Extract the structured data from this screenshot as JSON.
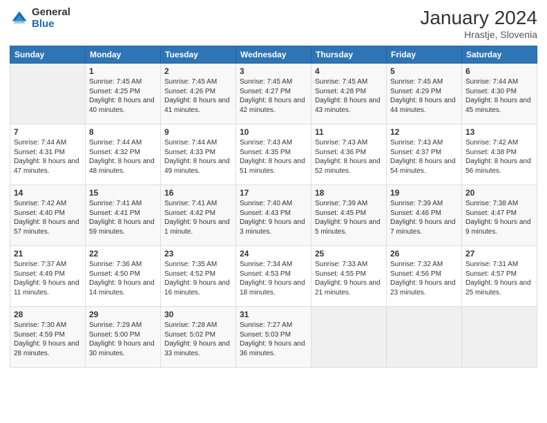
{
  "header": {
    "logo_general": "General",
    "logo_blue": "Blue",
    "month_year": "January 2024",
    "location": "Hrastje, Slovenia"
  },
  "weekdays": [
    "Sunday",
    "Monday",
    "Tuesday",
    "Wednesday",
    "Thursday",
    "Friday",
    "Saturday"
  ],
  "weeks": [
    [
      {
        "day": "",
        "sunrise": "",
        "sunset": "",
        "daylight": ""
      },
      {
        "day": "1",
        "sunrise": "Sunrise: 7:45 AM",
        "sunset": "Sunset: 4:25 PM",
        "daylight": "Daylight: 8 hours and 40 minutes."
      },
      {
        "day": "2",
        "sunrise": "Sunrise: 7:45 AM",
        "sunset": "Sunset: 4:26 PM",
        "daylight": "Daylight: 8 hours and 41 minutes."
      },
      {
        "day": "3",
        "sunrise": "Sunrise: 7:45 AM",
        "sunset": "Sunset: 4:27 PM",
        "daylight": "Daylight: 8 hours and 42 minutes."
      },
      {
        "day": "4",
        "sunrise": "Sunrise: 7:45 AM",
        "sunset": "Sunset: 4:28 PM",
        "daylight": "Daylight: 8 hours and 43 minutes."
      },
      {
        "day": "5",
        "sunrise": "Sunrise: 7:45 AM",
        "sunset": "Sunset: 4:29 PM",
        "daylight": "Daylight: 8 hours and 44 minutes."
      },
      {
        "day": "6",
        "sunrise": "Sunrise: 7:44 AM",
        "sunset": "Sunset: 4:30 PM",
        "daylight": "Daylight: 8 hours and 45 minutes."
      }
    ],
    [
      {
        "day": "7",
        "sunrise": "Sunrise: 7:44 AM",
        "sunset": "Sunset: 4:31 PM",
        "daylight": "Daylight: 8 hours and 47 minutes."
      },
      {
        "day": "8",
        "sunrise": "Sunrise: 7:44 AM",
        "sunset": "Sunset: 4:32 PM",
        "daylight": "Daylight: 8 hours and 48 minutes."
      },
      {
        "day": "9",
        "sunrise": "Sunrise: 7:44 AM",
        "sunset": "Sunset: 4:33 PM",
        "daylight": "Daylight: 8 hours and 49 minutes."
      },
      {
        "day": "10",
        "sunrise": "Sunrise: 7:43 AM",
        "sunset": "Sunset: 4:35 PM",
        "daylight": "Daylight: 8 hours and 51 minutes."
      },
      {
        "day": "11",
        "sunrise": "Sunrise: 7:43 AM",
        "sunset": "Sunset: 4:36 PM",
        "daylight": "Daylight: 8 hours and 52 minutes."
      },
      {
        "day": "12",
        "sunrise": "Sunrise: 7:43 AM",
        "sunset": "Sunset: 4:37 PM",
        "daylight": "Daylight: 8 hours and 54 minutes."
      },
      {
        "day": "13",
        "sunrise": "Sunrise: 7:42 AM",
        "sunset": "Sunset: 4:38 PM",
        "daylight": "Daylight: 8 hours and 56 minutes."
      }
    ],
    [
      {
        "day": "14",
        "sunrise": "Sunrise: 7:42 AM",
        "sunset": "Sunset: 4:40 PM",
        "daylight": "Daylight: 8 hours and 57 minutes."
      },
      {
        "day": "15",
        "sunrise": "Sunrise: 7:41 AM",
        "sunset": "Sunset: 4:41 PM",
        "daylight": "Daylight: 8 hours and 59 minutes."
      },
      {
        "day": "16",
        "sunrise": "Sunrise: 7:41 AM",
        "sunset": "Sunset: 4:42 PM",
        "daylight": "Daylight: 9 hours and 1 minute."
      },
      {
        "day": "17",
        "sunrise": "Sunrise: 7:40 AM",
        "sunset": "Sunset: 4:43 PM",
        "daylight": "Daylight: 9 hours and 3 minutes."
      },
      {
        "day": "18",
        "sunrise": "Sunrise: 7:39 AM",
        "sunset": "Sunset: 4:45 PM",
        "daylight": "Daylight: 9 hours and 5 minutes."
      },
      {
        "day": "19",
        "sunrise": "Sunrise: 7:39 AM",
        "sunset": "Sunset: 4:46 PM",
        "daylight": "Daylight: 9 hours and 7 minutes."
      },
      {
        "day": "20",
        "sunrise": "Sunrise: 7:38 AM",
        "sunset": "Sunset: 4:47 PM",
        "daylight": "Daylight: 9 hours and 9 minutes."
      }
    ],
    [
      {
        "day": "21",
        "sunrise": "Sunrise: 7:37 AM",
        "sunset": "Sunset: 4:49 PM",
        "daylight": "Daylight: 9 hours and 11 minutes."
      },
      {
        "day": "22",
        "sunrise": "Sunrise: 7:36 AM",
        "sunset": "Sunset: 4:50 PM",
        "daylight": "Daylight: 9 hours and 14 minutes."
      },
      {
        "day": "23",
        "sunrise": "Sunrise: 7:35 AM",
        "sunset": "Sunset: 4:52 PM",
        "daylight": "Daylight: 9 hours and 16 minutes."
      },
      {
        "day": "24",
        "sunrise": "Sunrise: 7:34 AM",
        "sunset": "Sunset: 4:53 PM",
        "daylight": "Daylight: 9 hours and 18 minutes."
      },
      {
        "day": "25",
        "sunrise": "Sunrise: 7:33 AM",
        "sunset": "Sunset: 4:55 PM",
        "daylight": "Daylight: 9 hours and 21 minutes."
      },
      {
        "day": "26",
        "sunrise": "Sunrise: 7:32 AM",
        "sunset": "Sunset: 4:56 PM",
        "daylight": "Daylight: 9 hours and 23 minutes."
      },
      {
        "day": "27",
        "sunrise": "Sunrise: 7:31 AM",
        "sunset": "Sunset: 4:57 PM",
        "daylight": "Daylight: 9 hours and 25 minutes."
      }
    ],
    [
      {
        "day": "28",
        "sunrise": "Sunrise: 7:30 AM",
        "sunset": "Sunset: 4:59 PM",
        "daylight": "Daylight: 9 hours and 28 minutes."
      },
      {
        "day": "29",
        "sunrise": "Sunrise: 7:29 AM",
        "sunset": "Sunset: 5:00 PM",
        "daylight": "Daylight: 9 hours and 30 minutes."
      },
      {
        "day": "30",
        "sunrise": "Sunrise: 7:28 AM",
        "sunset": "Sunset: 5:02 PM",
        "daylight": "Daylight: 9 hours and 33 minutes."
      },
      {
        "day": "31",
        "sunrise": "Sunrise: 7:27 AM",
        "sunset": "Sunset: 5:03 PM",
        "daylight": "Daylight: 9 hours and 36 minutes."
      },
      {
        "day": "",
        "sunrise": "",
        "sunset": "",
        "daylight": ""
      },
      {
        "day": "",
        "sunrise": "",
        "sunset": "",
        "daylight": ""
      },
      {
        "day": "",
        "sunrise": "",
        "sunset": "",
        "daylight": ""
      }
    ]
  ]
}
